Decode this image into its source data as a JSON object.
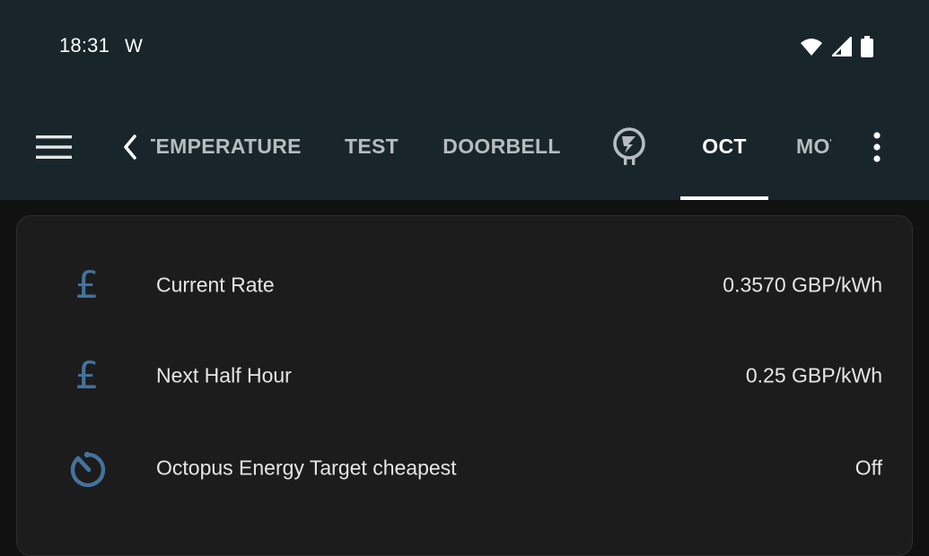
{
  "status_bar": {
    "time": "18:31",
    "notification_glyph": "W",
    "icons": [
      "wifi-icon",
      "cell-signal-icon",
      "battery-icon"
    ]
  },
  "toolbar": {
    "menu_icon": "hamburger-menu-icon",
    "scroll_left_icon": "chevron-left-icon",
    "more_icon": "more-vertical-icon",
    "tabs": [
      {
        "label": "TEMPERATURE",
        "active": false
      },
      {
        "label": "TEST",
        "active": false
      },
      {
        "label": "DOORBELL",
        "active": false
      },
      {
        "label": "",
        "icon": "ev-charger-icon",
        "active": false
      },
      {
        "label": "OCT",
        "active": true
      },
      {
        "label": "MOTION",
        "active": false
      }
    ]
  },
  "entities": [
    {
      "icon": "currency-gbp-icon",
      "label": "Current Rate",
      "value": "0.3570 GBP/kWh"
    },
    {
      "icon": "currency-gbp-icon",
      "label": "Next Half Hour",
      "value": "0.25 GBP/kWh"
    },
    {
      "icon": "timer-icon",
      "label": "Octopus Energy Target cheapest",
      "value": "Off"
    }
  ],
  "colors": {
    "header_bg": "#18262c",
    "page_bg": "#111111",
    "card_bg": "#1c1c1c",
    "icon_blue": "#44739e",
    "tab_text": "#b6bcbf",
    "tab_active": "#ffffff"
  }
}
